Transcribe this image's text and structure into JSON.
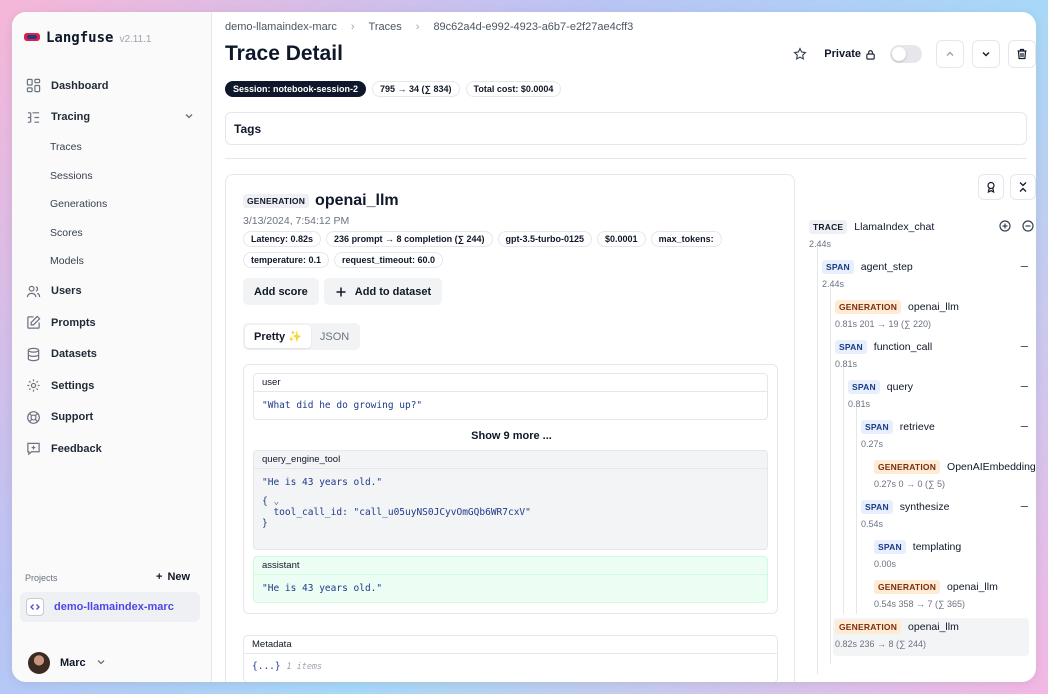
{
  "app": {
    "name": "Langfuse",
    "version": "v2.11.1"
  },
  "sidebar": {
    "items": [
      {
        "label": "Dashboard",
        "icon": "dashboard-icon"
      },
      {
        "label": "Tracing",
        "icon": "tracing-icon"
      },
      {
        "label": "Users",
        "icon": "users-icon"
      },
      {
        "label": "Prompts",
        "icon": "prompts-icon"
      },
      {
        "label": "Datasets",
        "icon": "datasets-icon"
      },
      {
        "label": "Settings",
        "icon": "gear-icon"
      },
      {
        "label": "Support",
        "icon": "lifebuoy-icon"
      },
      {
        "label": "Feedback",
        "icon": "feedback-icon"
      }
    ],
    "tracing_sub": [
      "Traces",
      "Sessions",
      "Generations",
      "Scores",
      "Models"
    ],
    "projects_label": "Projects",
    "new_label": "New",
    "project": "demo-llamaindex-marc",
    "user": "Marc"
  },
  "breadcrumb": [
    "demo-llamaindex-marc",
    "Traces",
    "89c62a4d-e992-4923-a6b7-e2f27ae4cff3"
  ],
  "page_title": "Trace Detail",
  "header": {
    "private_label": "Private"
  },
  "pills": {
    "session": "Session: notebook-session-2",
    "tokens": "795 → 34 (∑ 834)",
    "cost": "Total cost: $0.0004"
  },
  "tags_label": "Tags",
  "detail": {
    "badge": "GENERATION",
    "name": "openai_llm",
    "timestamp": "3/13/2024, 7:54:12 PM",
    "chips": [
      "Latency: 0.82s",
      "236 prompt → 8 completion (∑ 244)",
      "gpt-3.5-turbo-0125",
      "$0.0001",
      "max_tokens:",
      "temperature: 0.1",
      "request_timeout: 60.0"
    ],
    "add_score": "Add score",
    "add_dataset": "Add to dataset",
    "tab_pretty": "Pretty",
    "tab_json": "JSON",
    "messages": {
      "user_role": "user",
      "user_text": "\"What did he do growing up?\"",
      "show_more": "Show 9 more ...",
      "tool_role": "query_engine_tool",
      "tool_text": "\"He is 43 years old.\"",
      "tool_open": "{",
      "tool_key": "tool_call_id:",
      "tool_val": "\"call_u05uyNS0JCyvOmGQb6WR7cxV\"",
      "tool_close": "}",
      "assistant_role": "assistant",
      "assistant_text": "\"He is 43 years old.\""
    },
    "metadata_label": "Metadata",
    "metadata_value": "{...}",
    "metadata_count": "1 items"
  },
  "tree": [
    {
      "type": "TRACE",
      "name": "LlamaIndex_chat",
      "stats": "2.44s"
    },
    {
      "type": "SPAN",
      "name": "agent_step",
      "stats": "2.44s"
    },
    {
      "type": "GENERATION",
      "name": "openai_llm",
      "stats": "0.81s  201 → 19 (∑ 220)"
    },
    {
      "type": "SPAN",
      "name": "function_call",
      "stats": "0.81s"
    },
    {
      "type": "SPAN",
      "name": "query",
      "stats": "0.81s"
    },
    {
      "type": "SPAN",
      "name": "retrieve",
      "stats": "0.27s"
    },
    {
      "type": "GENERATION",
      "name": "OpenAIEmbedding",
      "stats": "0.27s  0 → 0 (∑ 5)"
    },
    {
      "type": "SPAN",
      "name": "synthesize",
      "stats": "0.54s"
    },
    {
      "type": "SPAN",
      "name": "templating",
      "stats": "0.00s"
    },
    {
      "type": "GENERATION",
      "name": "openai_llm",
      "stats": "0.54s  358 → 7 (∑ 365)"
    },
    {
      "type": "GENERATION",
      "name": "openai_llm",
      "stats": "0.82s  236 → 8 (∑ 244)"
    }
  ],
  "colors": {
    "accent": "#4f46e5",
    "span_badge": "#e6effb",
    "generation_badge": "#fdebd3",
    "assistant_bg": "#ecfdf3"
  }
}
